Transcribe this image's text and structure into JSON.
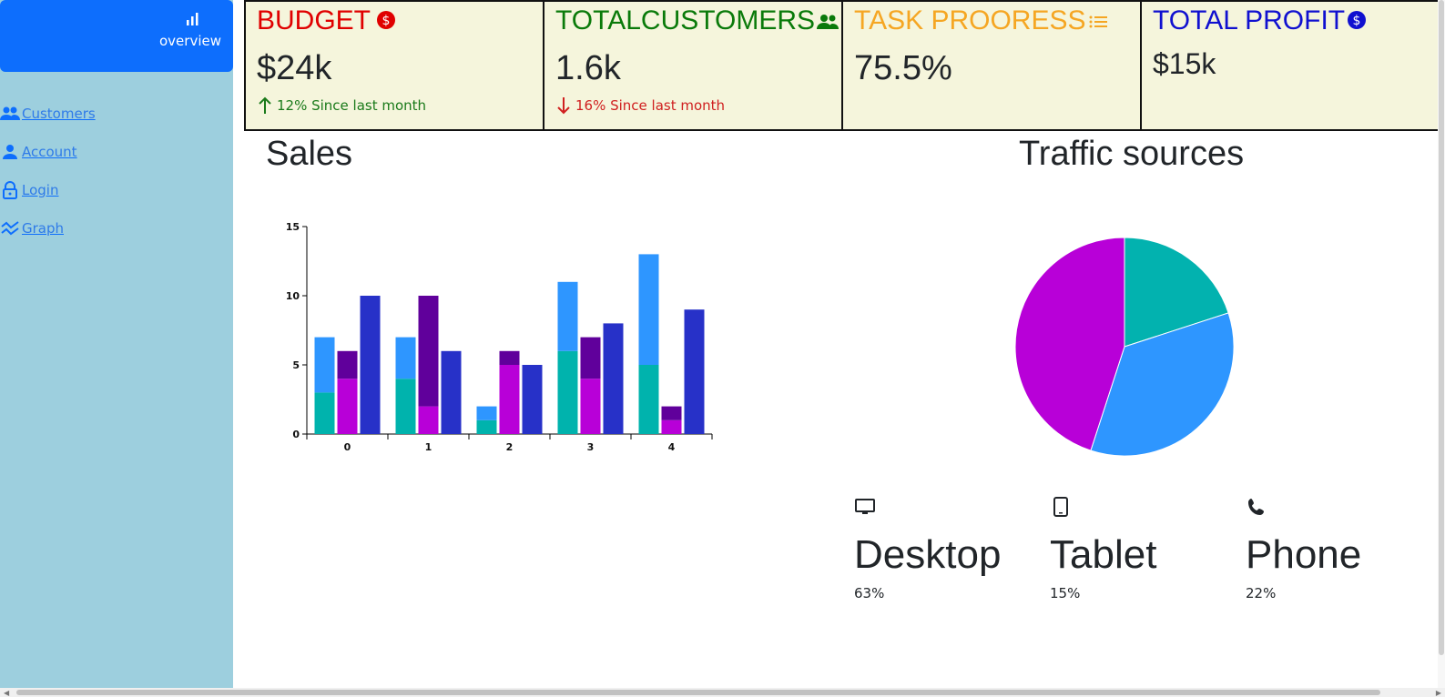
{
  "sidebar": {
    "overview_label": "overview",
    "items": [
      {
        "label": "Customers",
        "icon": "people-icon"
      },
      {
        "label": "Account",
        "icon": "person-icon"
      },
      {
        "label": "Login",
        "icon": "lock-icon"
      },
      {
        "label": "Graph",
        "icon": "graph-icon"
      }
    ]
  },
  "cards": {
    "budget": {
      "title": "BUDGET",
      "value": "$24k",
      "delta": "12% Since last month",
      "color": "#e00000",
      "delta_color": "#1a7a1a"
    },
    "customers": {
      "title": "TOTALCUSTOMERS",
      "value": "1.6k",
      "delta": "16% Since last month",
      "color": "#0a7a0a",
      "delta_color": "#d02020"
    },
    "task": {
      "title": "TASK PROORESS",
      "value": "75.5%",
      "color": "#f5a623"
    },
    "profit": {
      "title": "TOTAL PROFIT",
      "value": "$15k",
      "color": "#1010d0"
    }
  },
  "sales": {
    "title": "Sales"
  },
  "traffic": {
    "title": "Traffic sources",
    "devices": [
      {
        "name": "Desktop",
        "pct": "63%",
        "icon": "monitor-icon"
      },
      {
        "name": "Tablet",
        "pct": "15%",
        "icon": "tablet-icon"
      },
      {
        "name": "Phone",
        "pct": "22%",
        "icon": "phone-icon"
      }
    ]
  },
  "chart_data": [
    {
      "type": "bar",
      "title": "",
      "categories": [
        "0",
        "1",
        "2",
        "3",
        "4"
      ],
      "ylim": [
        0,
        15
      ],
      "yticks": [
        0,
        5,
        10,
        15
      ],
      "grid": false,
      "stacks": [
        {
          "segments": [
            {
              "values": [
                3,
                4,
                1,
                6,
                5
              ],
              "color": "#00b3ad"
            },
            {
              "values": [
                4,
                3,
                1,
                5,
                8
              ],
              "color": "#2e96ff"
            }
          ]
        },
        {
          "segments": [
            {
              "values": [
                4,
                2,
                5,
                4,
                1
              ],
              "color": "#b800d8"
            },
            {
              "values": [
                2,
                8,
                1,
                3,
                1
              ],
              "color": "#60009b"
            }
          ]
        },
        {
          "segments": [
            {
              "values": [
                10,
                6,
                5,
                8,
                9
              ],
              "color": "#2731c8"
            }
          ]
        }
      ]
    },
    {
      "type": "pie",
      "title": "",
      "slices": [
        {
          "value": 20,
          "color": "#02b2af"
        },
        {
          "value": 35,
          "color": "#2e96ff"
        },
        {
          "value": 45,
          "color": "#b800d8"
        }
      ]
    }
  ]
}
